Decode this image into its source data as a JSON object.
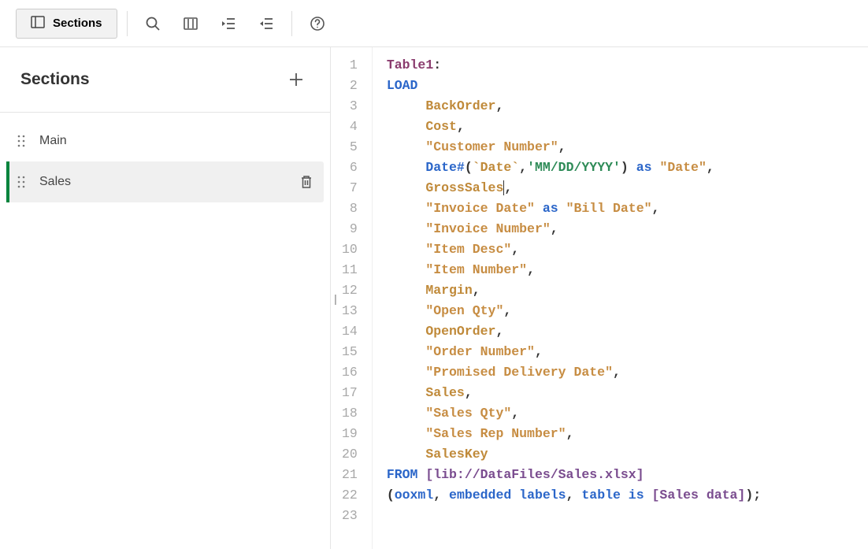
{
  "toolbar": {
    "sections_button_label": "Sections"
  },
  "sidebar": {
    "title": "Sections",
    "items": [
      {
        "label": "Main",
        "active": false
      },
      {
        "label": "Sales",
        "active": true
      }
    ]
  },
  "editor": {
    "lines": [
      [
        {
          "t": "name",
          "v": "Table1"
        },
        {
          "t": "punc",
          "v": ":"
        }
      ],
      [
        {
          "t": "kw",
          "v": "LOAD"
        }
      ],
      [
        {
          "t": "pad",
          "v": "     "
        },
        {
          "t": "id",
          "v": "BackOrder"
        },
        {
          "t": "punc",
          "v": ","
        }
      ],
      [
        {
          "t": "pad",
          "v": "     "
        },
        {
          "t": "id",
          "v": "Cost"
        },
        {
          "t": "punc",
          "v": ","
        }
      ],
      [
        {
          "t": "pad",
          "v": "     "
        },
        {
          "t": "str",
          "v": "\"Customer Number\""
        },
        {
          "t": "punc",
          "v": ","
        }
      ],
      [
        {
          "t": "pad",
          "v": "     "
        },
        {
          "t": "fn",
          "v": "Date#"
        },
        {
          "t": "punc",
          "v": "("
        },
        {
          "t": "id",
          "v": "`Date`"
        },
        {
          "t": "punc",
          "v": ","
        },
        {
          "t": "lit",
          "v": "'MM/DD/YYYY'"
        },
        {
          "t": "punc",
          "v": ")"
        },
        {
          "t": "pad",
          "v": " "
        },
        {
          "t": "kw",
          "v": "as"
        },
        {
          "t": "pad",
          "v": " "
        },
        {
          "t": "str",
          "v": "\"Date\""
        },
        {
          "t": "punc",
          "v": ","
        }
      ],
      [
        {
          "t": "pad",
          "v": "     "
        },
        {
          "t": "id",
          "v": "GrossSales"
        },
        {
          "t": "cursor",
          "v": ""
        },
        {
          "t": "punc",
          "v": ","
        }
      ],
      [
        {
          "t": "pad",
          "v": "     "
        },
        {
          "t": "str",
          "v": "\"Invoice Date\""
        },
        {
          "t": "pad",
          "v": " "
        },
        {
          "t": "kw",
          "v": "as"
        },
        {
          "t": "pad",
          "v": " "
        },
        {
          "t": "str",
          "v": "\"Bill Date\""
        },
        {
          "t": "punc",
          "v": ","
        }
      ],
      [
        {
          "t": "pad",
          "v": "     "
        },
        {
          "t": "str",
          "v": "\"Invoice Number\""
        },
        {
          "t": "punc",
          "v": ","
        }
      ],
      [
        {
          "t": "pad",
          "v": "     "
        },
        {
          "t": "str",
          "v": "\"Item Desc\""
        },
        {
          "t": "punc",
          "v": ","
        }
      ],
      [
        {
          "t": "pad",
          "v": "     "
        },
        {
          "t": "str",
          "v": "\"Item Number\""
        },
        {
          "t": "punc",
          "v": ","
        }
      ],
      [
        {
          "t": "pad",
          "v": "     "
        },
        {
          "t": "id",
          "v": "Margin"
        },
        {
          "t": "punc",
          "v": ","
        }
      ],
      [
        {
          "t": "pad",
          "v": "     "
        },
        {
          "t": "str",
          "v": "\"Open Qty\""
        },
        {
          "t": "punc",
          "v": ","
        }
      ],
      [
        {
          "t": "pad",
          "v": "     "
        },
        {
          "t": "id",
          "v": "OpenOrder"
        },
        {
          "t": "punc",
          "v": ","
        }
      ],
      [
        {
          "t": "pad",
          "v": "     "
        },
        {
          "t": "str",
          "v": "\"Order Number\""
        },
        {
          "t": "punc",
          "v": ","
        }
      ],
      [
        {
          "t": "pad",
          "v": "     "
        },
        {
          "t": "str",
          "v": "\"Promised Delivery Date\""
        },
        {
          "t": "punc",
          "v": ","
        }
      ],
      [
        {
          "t": "pad",
          "v": "     "
        },
        {
          "t": "id",
          "v": "Sales"
        },
        {
          "t": "punc",
          "v": ","
        }
      ],
      [
        {
          "t": "pad",
          "v": "     "
        },
        {
          "t": "str",
          "v": "\"Sales Qty\""
        },
        {
          "t": "punc",
          "v": ","
        }
      ],
      [
        {
          "t": "pad",
          "v": "     "
        },
        {
          "t": "str",
          "v": "\"Sales Rep Number\""
        },
        {
          "t": "punc",
          "v": ","
        }
      ],
      [
        {
          "t": "pad",
          "v": "     "
        },
        {
          "t": "id",
          "v": "SalesKey"
        }
      ],
      [
        {
          "t": "kw",
          "v": "FROM"
        },
        {
          "t": "pad",
          "v": " "
        },
        {
          "t": "bracket",
          "v": "[lib://DataFiles/Sales.xlsx]"
        }
      ],
      [
        {
          "t": "punc",
          "v": "("
        },
        {
          "t": "kw",
          "v": "ooxml"
        },
        {
          "t": "punc",
          "v": ", "
        },
        {
          "t": "kw",
          "v": "embedded labels"
        },
        {
          "t": "punc",
          "v": ", "
        },
        {
          "t": "kw",
          "v": "table is"
        },
        {
          "t": "pad",
          "v": " "
        },
        {
          "t": "bracket",
          "v": "[Sales data]"
        },
        {
          "t": "punc",
          "v": ");"
        }
      ],
      []
    ]
  }
}
